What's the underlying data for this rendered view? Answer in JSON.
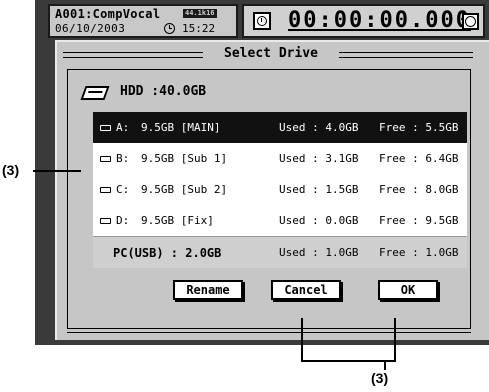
{
  "header": {
    "song": "A001:CompVocal",
    "badge": "44.1k16",
    "date": "06/10/2003",
    "time": "15:22",
    "counter": "00:00:00.000",
    "icons": [
      "timer-icon",
      "clock-icon",
      "alarm-icon"
    ]
  },
  "dialog": {
    "title": "Select Drive",
    "hdd_label": "HDD :40.0GB",
    "drives": [
      {
        "letter": "A:",
        "size": "9.5GB [MAIN]",
        "used": "Used : 4.0GB",
        "free": "Free : 5.5GB",
        "selected": true
      },
      {
        "letter": "B:",
        "size": "9.5GB [Sub 1]",
        "used": "Used : 3.1GB",
        "free": "Free : 6.4GB",
        "selected": false
      },
      {
        "letter": "C:",
        "size": "9.5GB [Sub 2]",
        "used": "Used : 1.5GB",
        "free": "Free : 8.0GB",
        "selected": false
      },
      {
        "letter": "D:",
        "size": "9.5GB [Fix]",
        "used": "Used : 0.0GB",
        "free": "Free : 9.5GB",
        "selected": false
      }
    ],
    "pc": {
      "label": "PC(USB) : 2.0GB",
      "used": "Used : 1.0GB",
      "free": "Free : 1.0GB"
    },
    "buttons": {
      "rename": "Rename",
      "cancel": "Cancel",
      "ok": "OK"
    }
  },
  "callouts": {
    "left": "(3)",
    "bottom": "(3)"
  },
  "colors": {
    "selected_row": "#111111",
    "dialog_bg": "#c6c6c6",
    "frame": "#3a3a3a"
  }
}
